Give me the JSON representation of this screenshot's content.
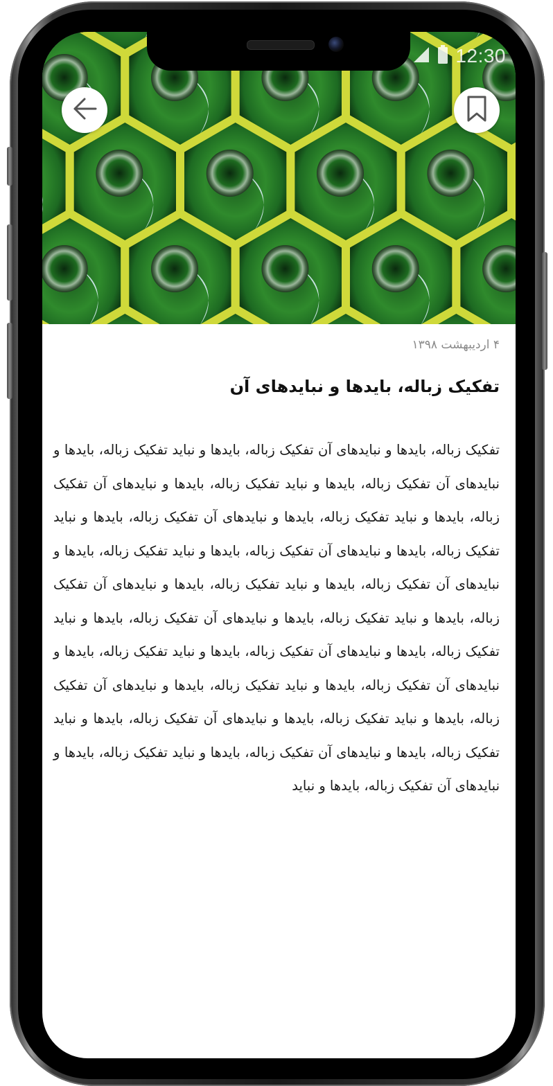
{
  "status_bar": {
    "time": "12:30",
    "signal_icon": "signal-icon",
    "battery_icon": "battery-icon"
  },
  "header": {
    "back_icon": "arrow-left-icon",
    "bookmark_icon": "bookmark-icon"
  },
  "hero_image": {
    "subject": "green glass bottles in yellow hexagonal crate"
  },
  "article": {
    "date": "۴ اردیبهشت ۱۳۹۸",
    "title": "تفکیک زباله، بایدها و نبایدهای آن",
    "body": "تفکیک زباله، بایدها و نبایدهای آن تفکیک زباله، بایدها و نباید تفکیک زباله، بایدها و نبایدهای آن تفکیک زباله، بایدها و نباید تفکیک زباله، بایدها و نبایدهای آن تفکیک زباله، بایدها و نباید تفکیک زباله، بایدها و نبایدهای آن تفکیک زباله، بایدها و نباید تفکیک زباله، بایدها و نبایدهای آن تفکیک زباله، بایدها و نباید تفکیک زباله، بایدها و نبایدهای آن تفکیک زباله، بایدها و نباید تفکیک زباله، بایدها و نبایدهای آن تفکیک زباله، بایدها و نباید تفکیک زباله، بایدها و نبایدهای آن تفکیک زباله، بایدها و نباید تفکیک زباله، بایدها و نبایدهای آن تفکیک زباله، بایدها و نباید تفکیک زباله، بایدها و نبایدهای آن تفکیک زباله، بایدها و نباید تفکیک زباله، بایدها و نبایدهای آن تفکیک زباله، بایدها و نباید تفکیک زباله، بایدها و نبایدهای آن تفکیک زباله، بایدها و نباید تفکیک زباله، بایدها و نبایدهای آن تفکیک زباله، بایدها و نباید تفکیک زباله، بایدها و نبایدهای آن تفکیک زباله، بایدها و نباید"
  },
  "colors": {
    "background": "#ffffff",
    "title_text": "#111111",
    "body_text": "#1a1a1a",
    "date_text": "#8a8a8a",
    "crate_yellow": "#cfd93a",
    "bottle_green": "#1f6b22"
  }
}
